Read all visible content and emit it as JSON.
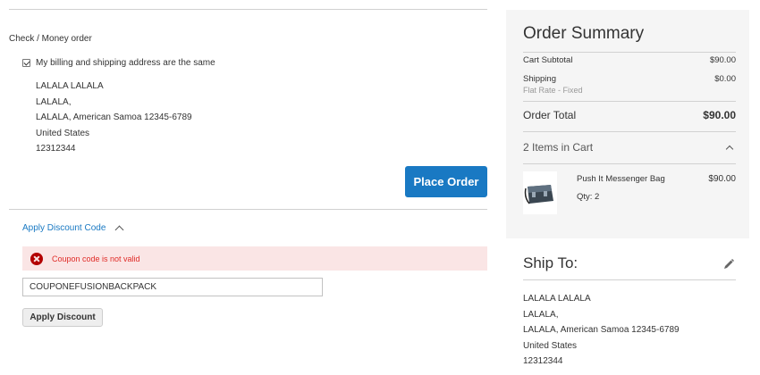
{
  "payment": {
    "method_label": "Check / Money order",
    "same_address_label": "My billing and shipping address are the same",
    "same_address_checked": true,
    "billing_address": [
      "LALALA LALALA",
      "LALALA,",
      "LALALA, American Samoa 12345-6789",
      "United States",
      "12312344"
    ],
    "place_order_label": "Place Order"
  },
  "discount": {
    "toggle_label": "Apply Discount Code",
    "toggle_icon": "chevron-up-icon",
    "error_icon": "error-circle-icon",
    "error_message": "Coupon code is not valid",
    "coupon_value": "COUPONEFUSIONBACKPACK",
    "apply_label": "Apply Discount"
  },
  "summary": {
    "title": "Order Summary",
    "subtotal_label": "Cart Subtotal",
    "subtotal_value": "$90.00",
    "shipping_label": "Shipping",
    "shipping_value": "$0.00",
    "shipping_method": "Flat Rate - Fixed",
    "total_label": "Order Total",
    "total_value": "$90.00",
    "items_label": "2 Items in Cart",
    "items": [
      {
        "name": "Push It Messenger Bag",
        "price": "$90.00",
        "qty": "Qty: 2",
        "image_icon": "messenger-bag-icon"
      }
    ]
  },
  "ship_to": {
    "title": "Ship To:",
    "edit_icon": "pencil-icon",
    "address": [
      "LALALA LALALA",
      "LALALA,",
      "LALALA, American Samoa 12345-6789",
      "United States",
      "12312344"
    ]
  },
  "colors": {
    "primary": "#1979c3",
    "error_bg": "#fae5e5",
    "error_text": "#e02b27",
    "summary_bg": "#f5f5f5"
  }
}
